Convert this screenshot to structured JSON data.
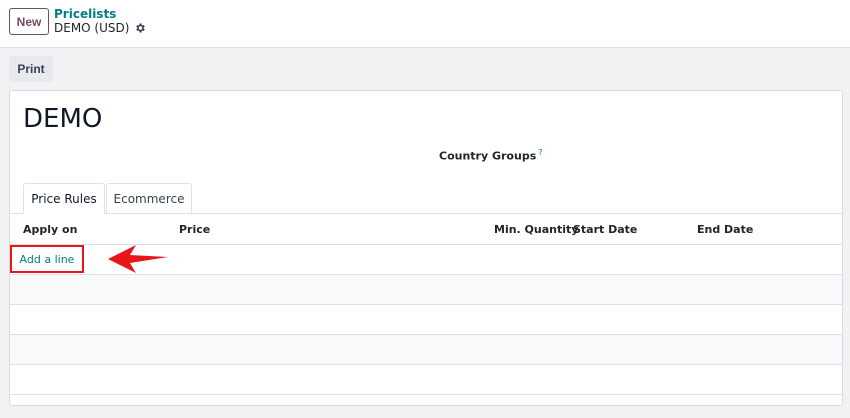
{
  "topbar": {
    "new_label": "New",
    "breadcrumb": "Pricelists",
    "record_name": "DEMO (USD)",
    "gear_icon": "gear-icon"
  },
  "toolbar": {
    "print_label": "Print"
  },
  "form": {
    "title": "DEMO",
    "country_groups_label": "Country Groups",
    "help_marker": "?"
  },
  "tabs": [
    {
      "label": "Price Rules",
      "active": true
    },
    {
      "label": "Ecommerce",
      "active": false
    }
  ],
  "table": {
    "columns": [
      "Apply on",
      "Price",
      "Min. Quantity",
      "Start Date",
      "End Date"
    ],
    "add_line_label": "Add a line"
  },
  "annotation": {
    "highlight_color": "#e8161b",
    "arrow_icon": "left-arrow-icon"
  },
  "colors": {
    "brand": "#714b67",
    "link": "#017e84"
  }
}
